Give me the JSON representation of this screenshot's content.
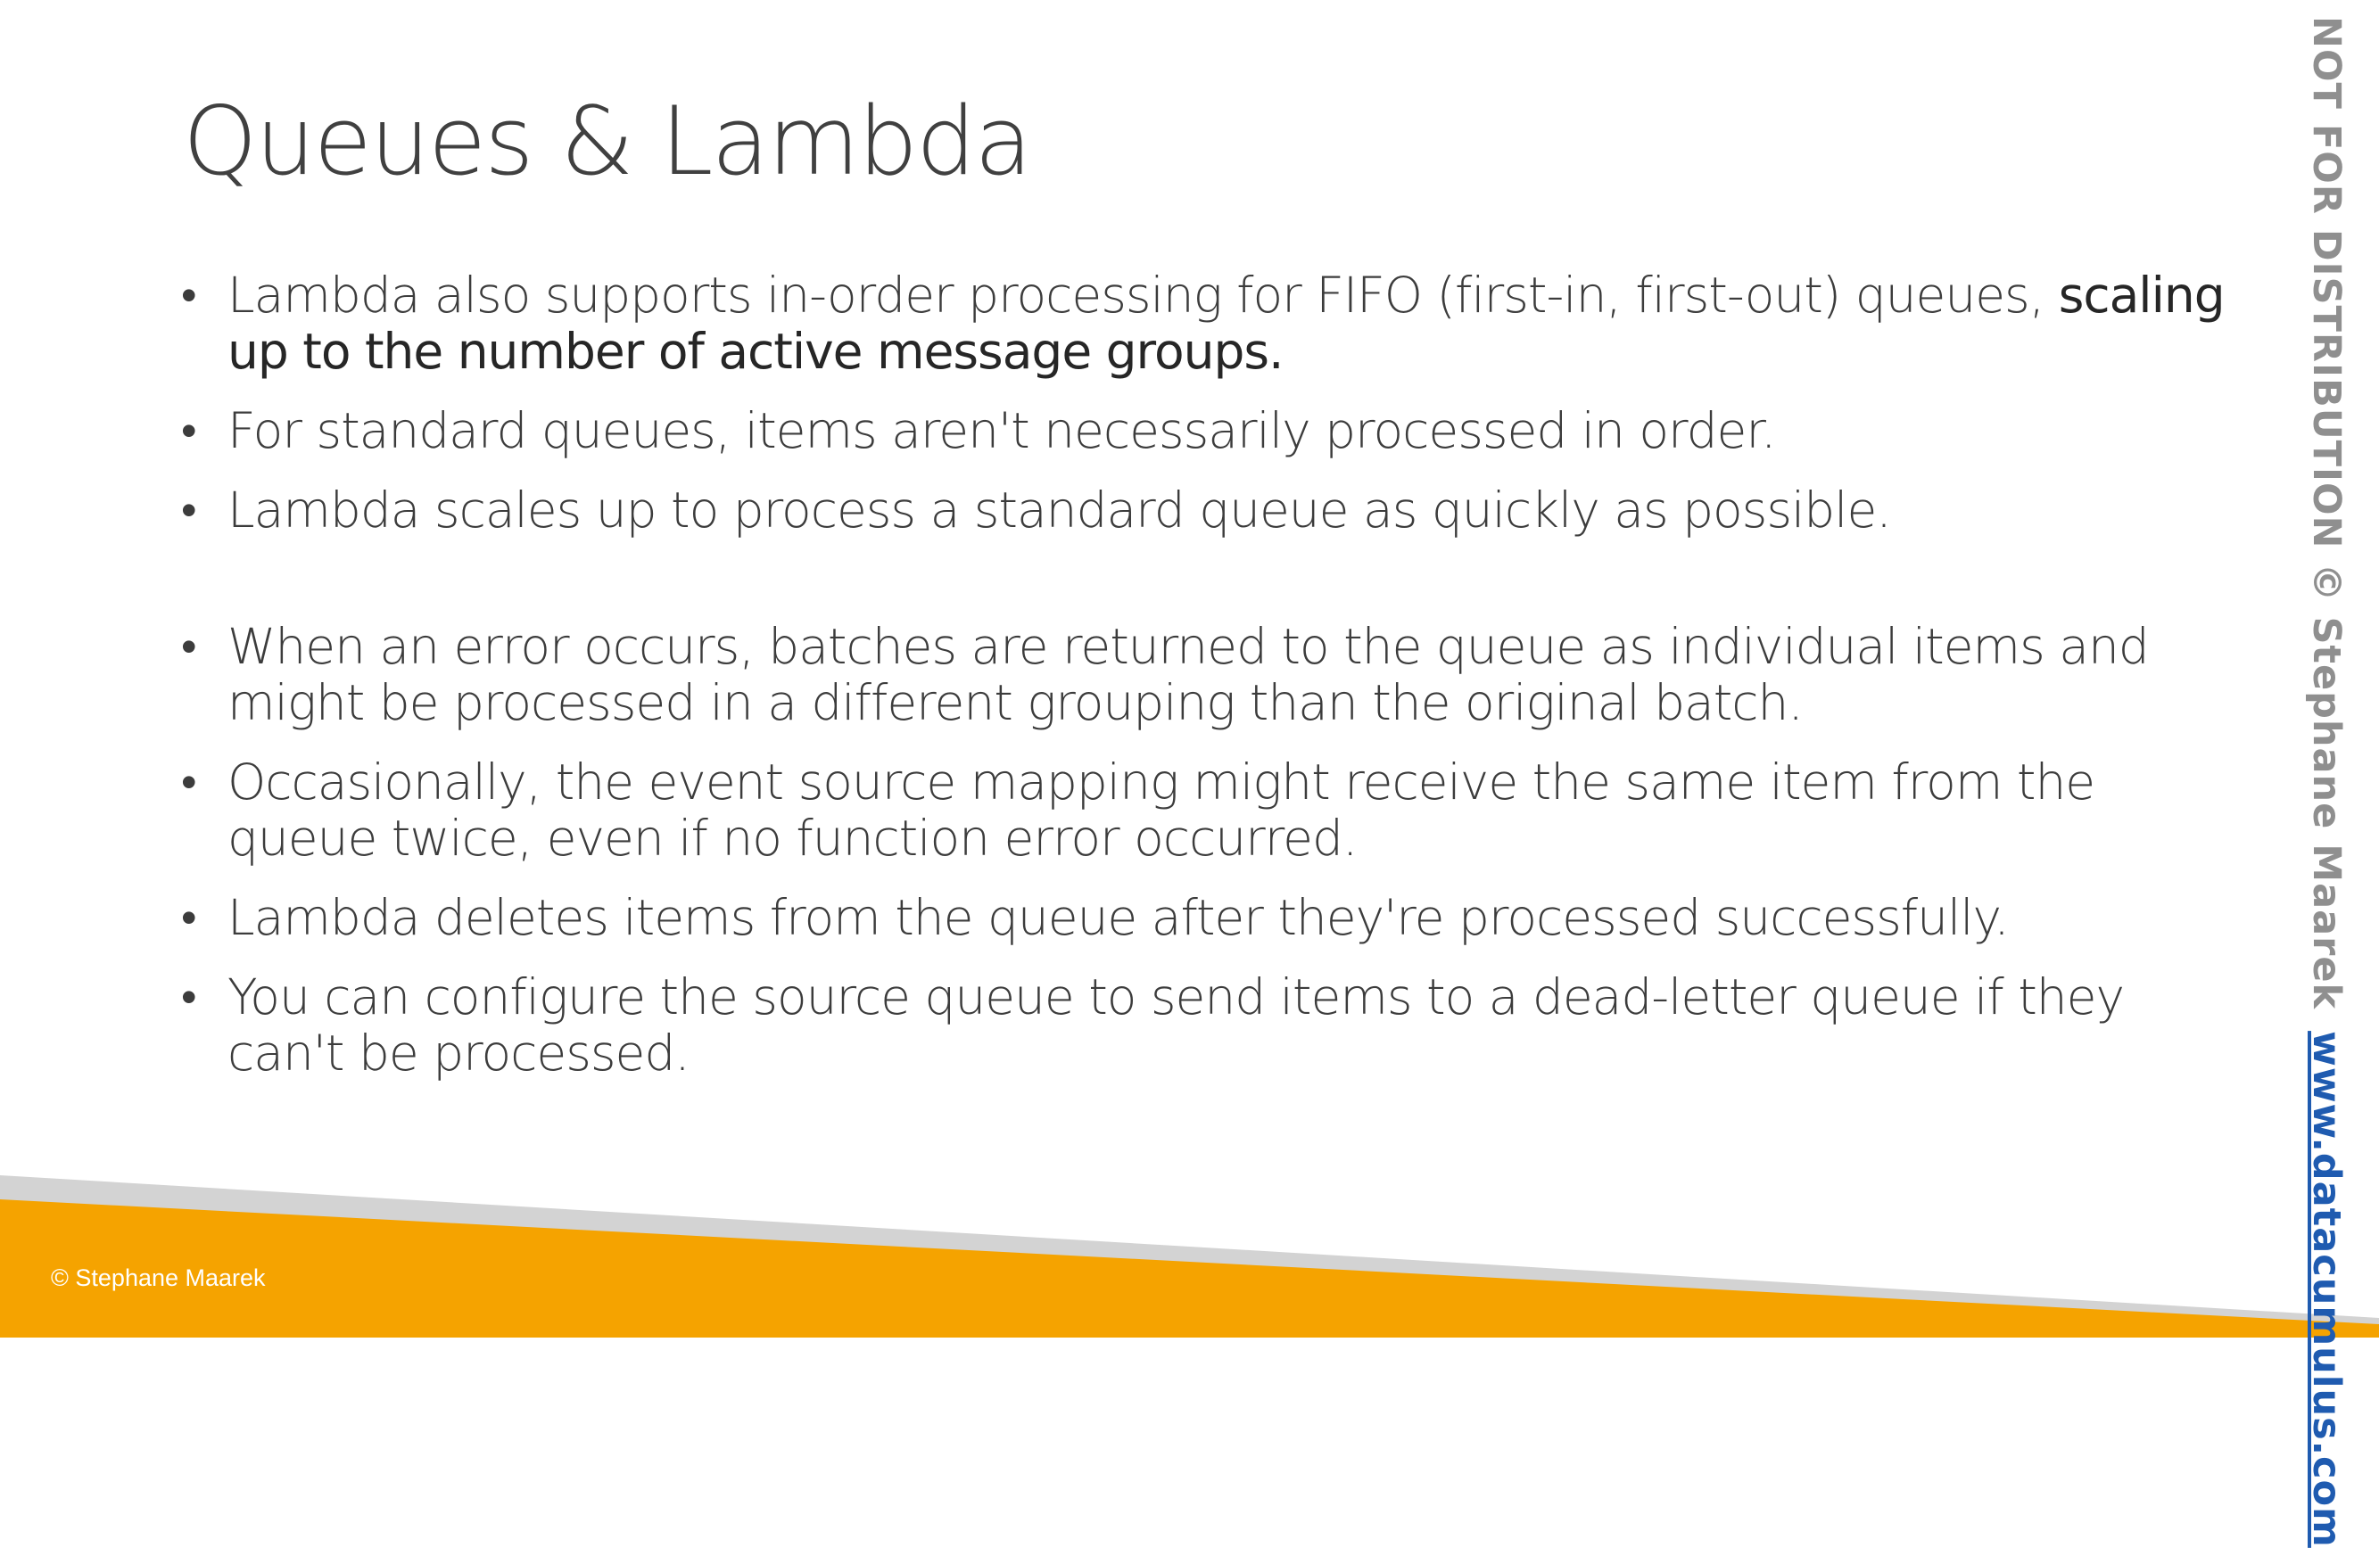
{
  "slide": {
    "title": "Queues & Lambda"
  },
  "bullets": [
    {
      "text": "Lambda also supports in-order processing for FIFO (first-in, first-out) queues, ",
      "bold": "scaling up to the number of active message groups."
    },
    {
      "text": "For standard queues, items aren't necessarily processed in order."
    },
    {
      "text": "Lambda scales up to process a standard queue as quickly as possible."
    },
    {
      "text": "When an error occurs, batches are returned to the queue as individual items and might be processed in a different grouping than the original batch."
    },
    {
      "text": "Occasionally, the event source mapping might receive the same item from the queue twice, even if no function error occurred."
    },
    {
      "text": "Lambda deletes items from the queue after they're processed successfully."
    },
    {
      "text": "You can configure the source queue to send items to a dead-letter queue if they can't be processed."
    }
  ],
  "bullet_glyph": "•",
  "watermark": {
    "text": "NOT FOR DISTRIBUTION © Stephane Maarek",
    "link": "www.datacumulus.com"
  },
  "footer": {
    "copyright": "© Stephane Maarek"
  },
  "colors": {
    "footer_orange": "#f5a300",
    "footer_gray": "#d3d3d3",
    "link_blue": "#1f5bb0",
    "text": "#404040"
  }
}
